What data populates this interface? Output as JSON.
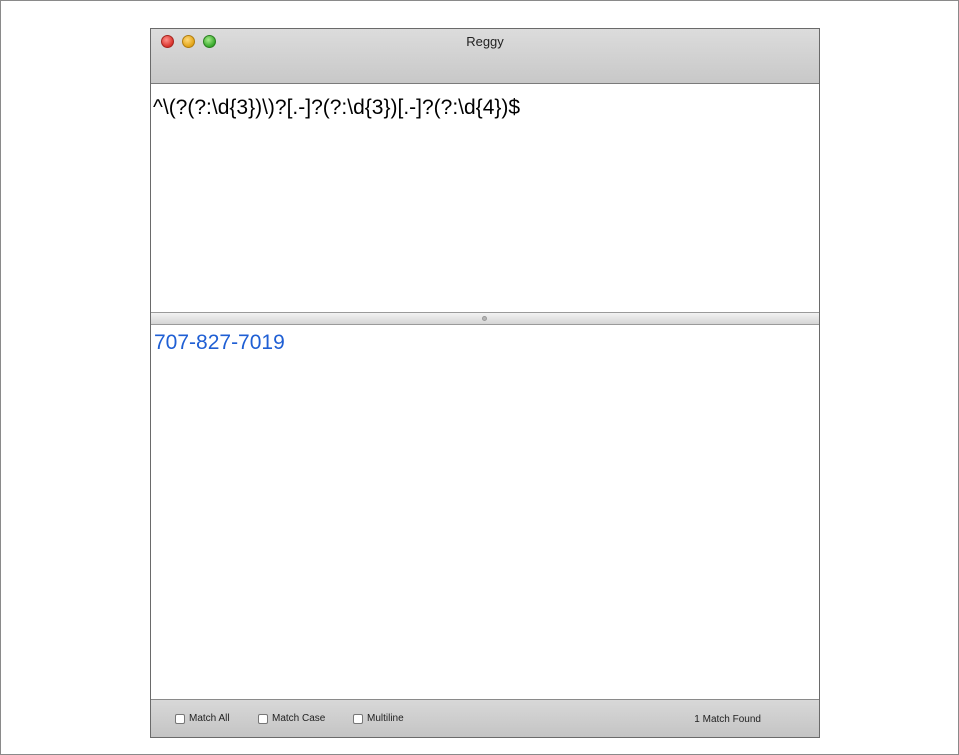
{
  "window": {
    "title": "Reggy"
  },
  "pattern": {
    "value": "^\\(?(?:\\d{3})\\)?[.-]?(?:\\d{3})[.-]?(?:\\d{4})$"
  },
  "sample": {
    "value": "707-827-7019",
    "highlight_color": "#1f5fd4"
  },
  "options": [
    {
      "label": "Match All",
      "checked": false
    },
    {
      "label": "Match Case",
      "checked": false
    },
    {
      "label": "Multiline",
      "checked": false
    }
  ],
  "status": {
    "text": "1 Match Found"
  }
}
